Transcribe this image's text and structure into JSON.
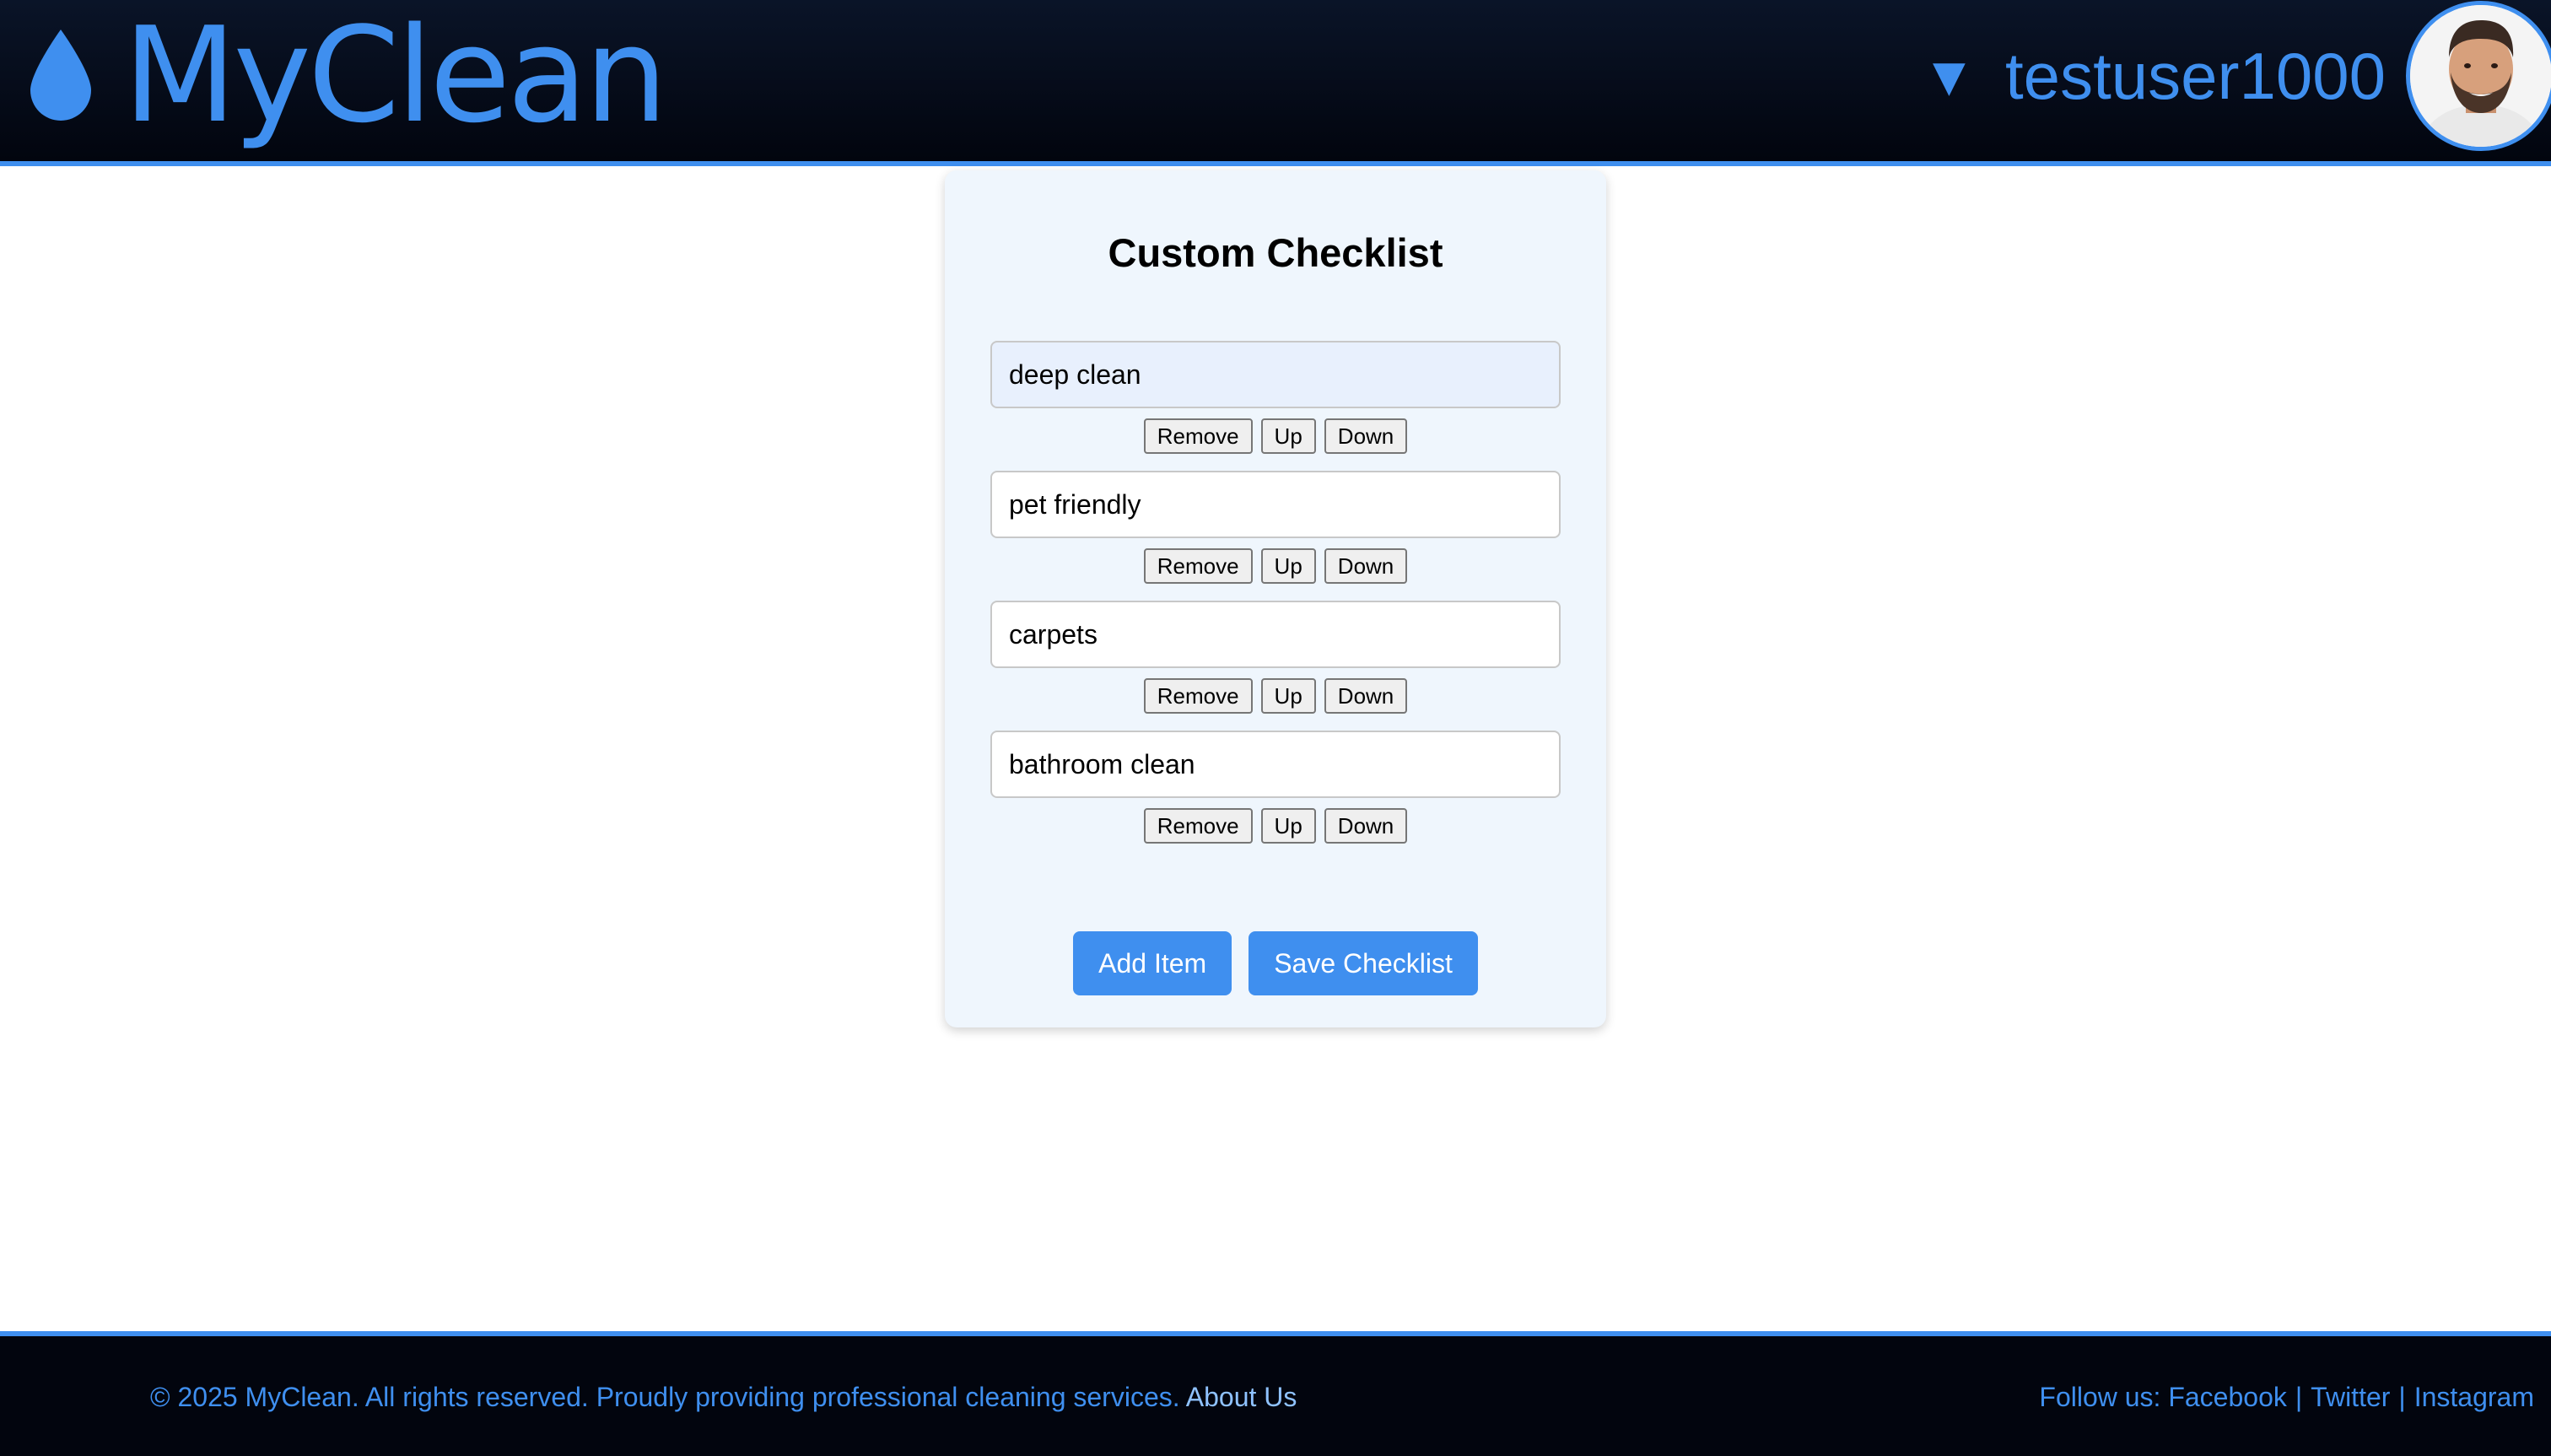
{
  "header": {
    "logo_text": "MyClean",
    "username": "testuser1000",
    "caret": "▼"
  },
  "checklist": {
    "title": "Custom Checklist",
    "items": [
      {
        "value": "deep clean"
      },
      {
        "value": "pet friendly"
      },
      {
        "value": "carpets"
      },
      {
        "value": "bathroom clean"
      }
    ],
    "item_buttons": {
      "remove": "Remove",
      "up": "Up",
      "down": "Down"
    },
    "add_label": "Add Item",
    "save_label": "Save Checklist"
  },
  "footer": {
    "copyright": "© 2025 MyClean. All rights reserved. Proudly providing professional cleaning services.",
    "about_link": "About Us",
    "follow_label": "Follow us:",
    "social": [
      "Facebook",
      "Twitter",
      "Instagram"
    ],
    "separator": "|"
  },
  "colors": {
    "accent": "#3f8fef",
    "header_bg": "#02050e",
    "card_bg": "#eff6fd"
  }
}
